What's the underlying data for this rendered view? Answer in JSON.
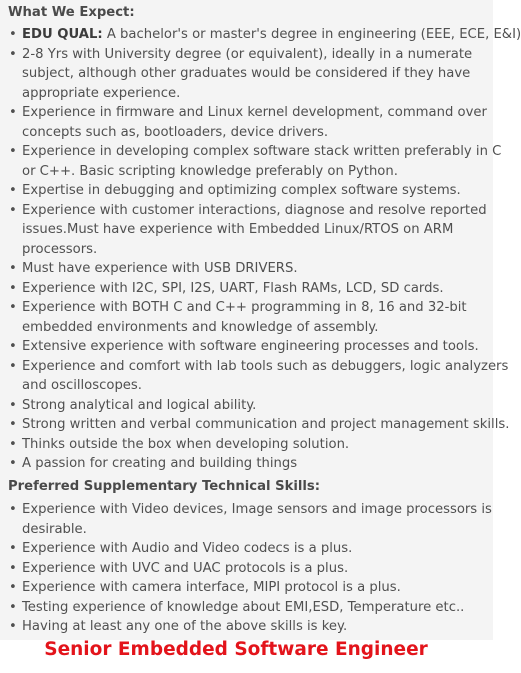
{
  "section_expect": {
    "heading": "What We Expect:",
    "items": [
      {
        "label": "EDU QUAL:",
        "lines": [
          " A bachelor's or master's degree in engineering (EEE, ECE, E&I)"
        ]
      },
      {
        "label": "",
        "lines": [
          "2-8 Yrs with University degree (or equivalent), ideally in a numerate",
          "subject, although other graduates would be considered if they have",
          "appropriate experience."
        ]
      },
      {
        "label": "",
        "lines": [
          "Experience in firmware and Linux kernel development, command over",
          "concepts such as, bootloaders, device drivers."
        ]
      },
      {
        "label": "",
        "lines": [
          "Experience in developing complex software stack written preferably in C",
          "or C++. Basic scripting knowledge preferably on Python."
        ]
      },
      {
        "label": "",
        "lines": [
          "Expertise in debugging and optimizing complex software systems."
        ]
      },
      {
        "label": "",
        "lines": [
          "Experience with customer interactions, diagnose and resolve reported",
          "issues.Must have experience with Embedded Linux/RTOS on ARM",
          "processors."
        ]
      },
      {
        "label": "",
        "lines": [
          "Must have experience with USB DRIVERS."
        ]
      },
      {
        "label": "",
        "lines": [
          "Experience with I2C, SPI, I2S, UART, Flash RAMs, LCD, SD cards."
        ]
      },
      {
        "label": "",
        "lines": [
          "Experience with BOTH C and C++ programming in 8, 16 and 32-bit",
          "embedded environments and knowledge of assembly."
        ]
      },
      {
        "label": "",
        "lines": [
          "Extensive experience with software engineering processes and tools."
        ]
      },
      {
        "label": "",
        "lines": [
          "Experience and comfort with lab tools such as debuggers, logic analyzers",
          "and oscilloscopes."
        ]
      },
      {
        "label": "",
        "lines": [
          "Strong analytical and logical ability."
        ]
      },
      {
        "label": "",
        "lines": [
          "Strong written and verbal communication and project management skills."
        ]
      },
      {
        "label": "",
        "lines": [
          "Thinks outside the box when developing solution."
        ]
      },
      {
        "label": "",
        "lines": [
          "A passion for creating and building things"
        ]
      }
    ]
  },
  "section_preferred": {
    "heading": "Preferred Supplementary Technical Skills:",
    "items": [
      {
        "label": "",
        "lines": [
          "Experience with Video devices, Image sensors and image processors is",
          "desirable."
        ]
      },
      {
        "label": "",
        "lines": [
          "Experience with Audio and Video codecs is a plus."
        ]
      },
      {
        "label": "",
        "lines": [
          "Experience with UVC and UAC protocols is a plus."
        ]
      },
      {
        "label": "",
        "lines": [
          "Experience with camera interface, MIPI protocol is a plus."
        ]
      },
      {
        "label": "",
        "lines": [
          "Testing experience of knowledge about EMI,ESD, Temperature etc.."
        ]
      },
      {
        "label": "",
        "lines": [
          "Having at least any one of the above skills is key."
        ]
      }
    ]
  },
  "job_title": "Senior Embedded Software Engineer",
  "colors": {
    "title": "#e3141b",
    "panel_background": "#f4f4f4",
    "body_text": "#505050"
  }
}
